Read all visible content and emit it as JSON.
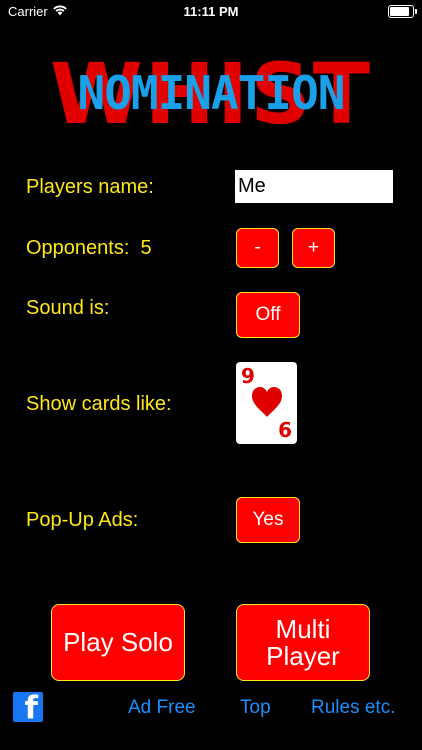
{
  "status_bar": {
    "carrier": "Carrier",
    "time": "11:11 PM",
    "battery_level": 0.85
  },
  "logo": {
    "back_text": "WHIST",
    "front_text": "NOMINATION"
  },
  "settings": {
    "players_name_label": "Players name:",
    "players_name_value": "Me",
    "opponents_label": "Opponents:",
    "opponents_count": "5",
    "minus_label": "-",
    "plus_label": "+",
    "sound_label": "Sound is:",
    "sound_value": "Off",
    "show_cards_label": "Show cards like:",
    "card_rank": "9",
    "card_rank_bottom": "6",
    "card_suit": "heart",
    "popup_ads_label": "Pop-Up Ads:",
    "popup_ads_value": "Yes"
  },
  "actions": {
    "play_solo": "Play Solo",
    "multi_player": "Multi Player"
  },
  "footer": {
    "facebook": "facebook",
    "ad_free": "Ad Free",
    "top": "Top",
    "rules": "Rules etc."
  },
  "colors": {
    "background": "#000000",
    "label": "#ffe81a",
    "button": "#ff0000",
    "link": "#1a8fff",
    "logo_red": "#e10000",
    "logo_blue": "#1aa0e8"
  }
}
